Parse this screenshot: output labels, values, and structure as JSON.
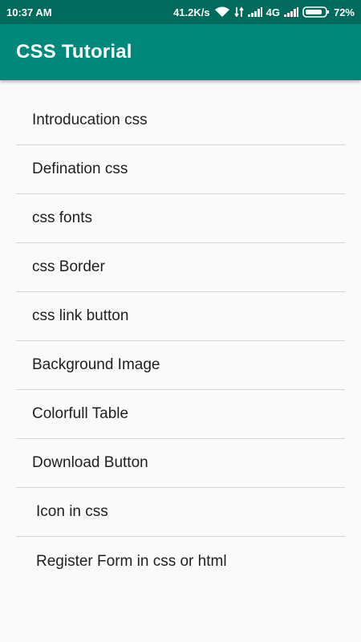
{
  "status_bar": {
    "time": "10:37 AM",
    "network_speed": "41.2K/s",
    "network_type": "4G",
    "battery": "72%",
    "icons": [
      "wifi-icon",
      "data-transfer-icon",
      "signal-icon",
      "signal-icon",
      "battery-icon"
    ]
  },
  "app_bar": {
    "title": "CSS Tutorial",
    "color": "#00897b",
    "status_color": "#006a5c"
  },
  "list": {
    "items": [
      {
        "label": "Introducation css"
      },
      {
        "label": "Defination css"
      },
      {
        "label": "css fonts"
      },
      {
        "label": "css Border"
      },
      {
        "label": "css link button"
      },
      {
        "label": "Background Image"
      },
      {
        "label": "Colorfull Table"
      },
      {
        "label": "Download Button"
      },
      {
        "label": "Icon in css"
      },
      {
        "label": "Register Form in css or html"
      }
    ]
  }
}
